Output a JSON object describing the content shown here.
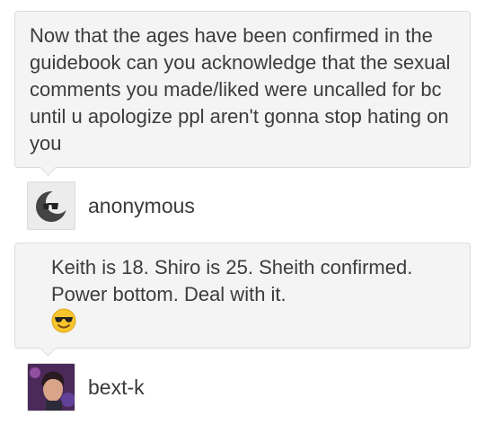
{
  "question": {
    "text": "Now that the ages have been confirmed in the guidebook can you acknowledge that the sexual comments you made/liked were uncalled for bc until u apologize ppl aren't gonna stop hating on you",
    "asker": "anonymous",
    "asker_icon": "anonymous-sunglasses-icon"
  },
  "answer": {
    "text": "Keith is 18. Shiro is 25. Sheith confirmed. Power bottom. Deal with it.",
    "emoji": "sunglasses-emoji",
    "author": "bext-k"
  },
  "colors": {
    "bubble_bg": "#f4f4f4",
    "bubble_border": "#dcdcdc",
    "text": "#3c3c3c"
  }
}
